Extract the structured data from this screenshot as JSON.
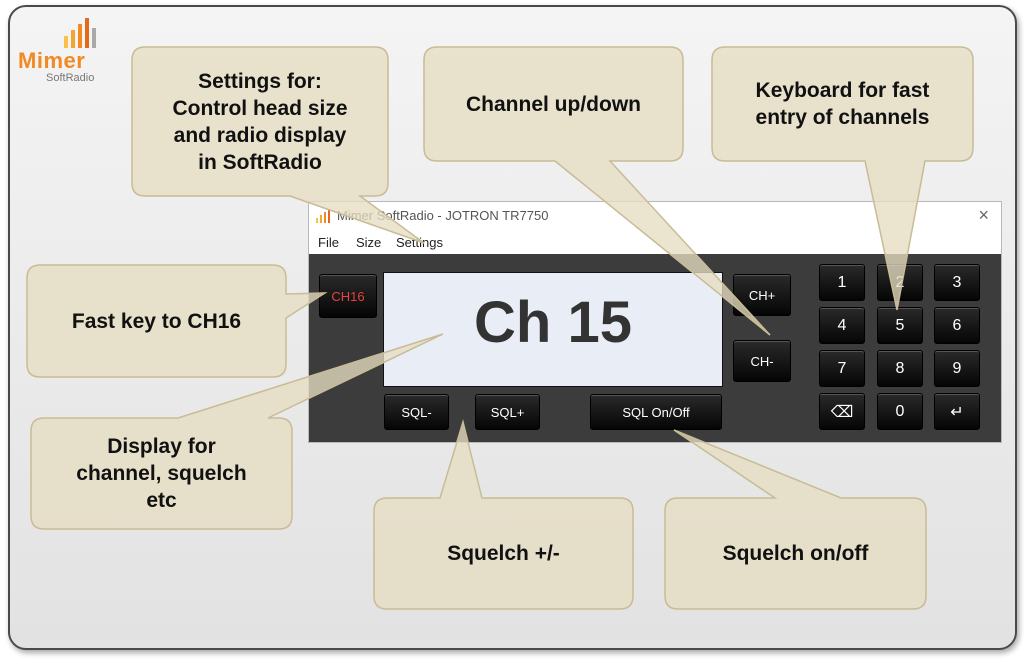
{
  "logo": {
    "name": "Mimer",
    "sub": "SoftRadio"
  },
  "window": {
    "title": "Mimer SoftRadio - JOTRON TR7750",
    "close": "×",
    "menu": [
      "File",
      "Size",
      "Settings"
    ]
  },
  "radio": {
    "display": "Ch 15",
    "ch16": "CH16",
    "ch_up": "CH+",
    "ch_down": "CH-",
    "sql_minus": "SQL-",
    "sql_plus": "SQL+",
    "sql_toggle": "SQL On/Off",
    "keys": [
      "1",
      "2",
      "3",
      "4",
      "5",
      "6",
      "7",
      "8",
      "9",
      "⌫",
      "0",
      "↵"
    ]
  },
  "callouts": {
    "settings": "Settings for:\nControl head size\nand radio display\nin SoftRadio",
    "channel": "Channel up/down",
    "keyboard": "Keyboard for fast\nentry of channels",
    "fastkey": "Fast key to CH16",
    "display": "Display for\nchannel, squelch\netc",
    "squelch_pm": "Squelch +/-",
    "squelch_onoff": "Squelch on/off"
  },
  "colors": {
    "callout_fill": "#e6dcc1",
    "callout_edge": "#c8bb96",
    "brand_orange": "#f08a24",
    "ch16_red": "#e8403c"
  }
}
